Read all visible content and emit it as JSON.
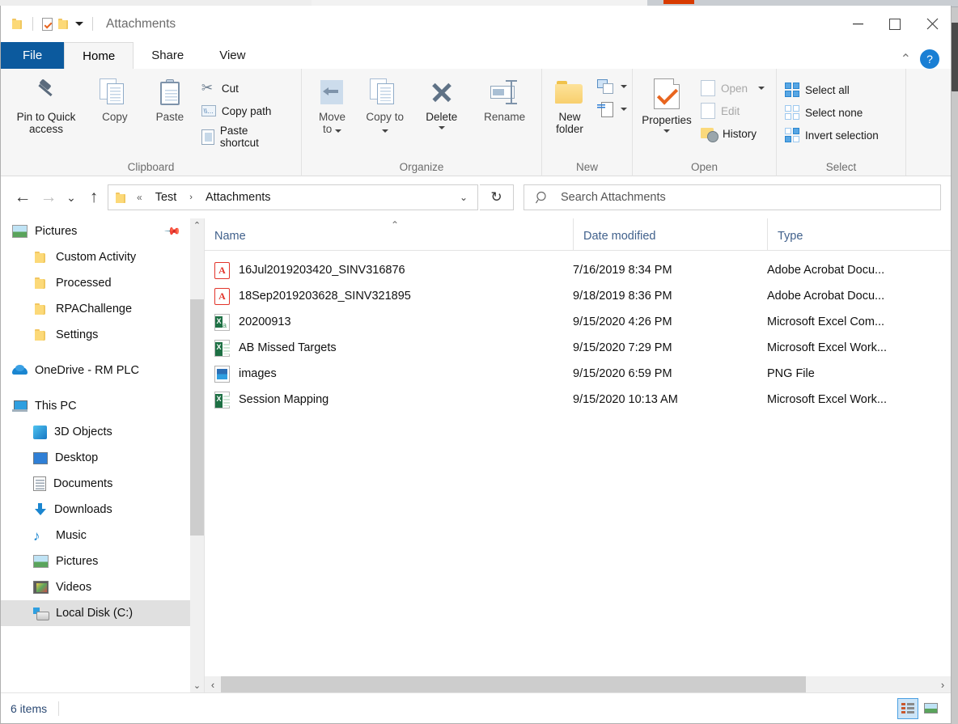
{
  "window": {
    "title": "Attachments",
    "minimize_label": "—",
    "maximize_label": "□",
    "close_label": "✕"
  },
  "quick_access": {
    "folder_icon": "folder-icon",
    "properties_icon": "properties-check-icon",
    "newfolder_icon": "folder-icon",
    "customize_label": "▾"
  },
  "tabs": [
    {
      "label": "File",
      "state": "file"
    },
    {
      "label": "Home",
      "state": "active"
    },
    {
      "label": "Share",
      "state": "normal"
    },
    {
      "label": "View",
      "state": "normal"
    }
  ],
  "ribbon_controls": {
    "collapse_label": "⌃",
    "help_label": "?"
  },
  "ribbon": {
    "groups": [
      {
        "label": "Clipboard",
        "big": [
          {
            "label": "Pin to Quick access",
            "icon": "pin-icon"
          },
          {
            "label": "Copy",
            "icon": "copy-icon"
          },
          {
            "label": "Paste",
            "icon": "paste-icon"
          }
        ],
        "small": [
          {
            "label": "Cut",
            "icon": "scissors-icon"
          },
          {
            "label": "Copy path",
            "icon": "copy-path-icon"
          },
          {
            "label": "Paste shortcut",
            "icon": "paste-shortcut-icon"
          }
        ]
      },
      {
        "label": "Organize",
        "big": [
          {
            "label": "Move to",
            "icon": "move-to-icon"
          },
          {
            "label": "Copy to",
            "icon": "copy-to-icon"
          },
          {
            "label": "Delete",
            "icon": "delete-x-icon"
          },
          {
            "label": "Rename",
            "icon": "rename-icon"
          }
        ],
        "small": []
      },
      {
        "label": "New",
        "big": [
          {
            "label": "New folder",
            "icon": "new-folder-icon"
          }
        ],
        "small": [
          {
            "label": "",
            "icon": "new-item-icon"
          },
          {
            "label": "",
            "icon": "easy-access-icon"
          }
        ]
      },
      {
        "label": "Open",
        "big": [
          {
            "label": "Properties",
            "icon": "properties-icon"
          }
        ],
        "small": [
          {
            "label": "Open",
            "icon": "open-icon"
          },
          {
            "label": "Edit",
            "icon": "edit-icon"
          },
          {
            "label": "History",
            "icon": "history-icon"
          }
        ]
      },
      {
        "label": "Select",
        "big": [],
        "small": [
          {
            "label": "Select all",
            "icon": "select-all-icon"
          },
          {
            "label": "Select none",
            "icon": "select-none-icon"
          },
          {
            "label": "Invert selection",
            "icon": "invert-selection-icon"
          }
        ]
      }
    ]
  },
  "address": {
    "back_label": "←",
    "forward_label": "→",
    "recent_label": "⌄",
    "up_label": "↑",
    "overflow_label": "«",
    "crumbs": [
      "Test",
      "Attachments"
    ],
    "crumb_separator": "›",
    "dropdown_label": "⌄",
    "refresh_label": "↻"
  },
  "search": {
    "icon": "search-icon",
    "placeholder": "Search Attachments"
  },
  "sidebar": {
    "items": [
      {
        "label": "Pictures",
        "icon": "picture-icon",
        "indent": "root",
        "pinned": true
      },
      {
        "label": "Custom Activity",
        "icon": "folder-icon",
        "indent": "ind1"
      },
      {
        "label": "Processed",
        "icon": "folder-icon",
        "indent": "ind1"
      },
      {
        "label": "RPAChallenge",
        "icon": "folder-icon",
        "indent": "ind1"
      },
      {
        "label": "Settings",
        "icon": "folder-icon",
        "indent": "ind1"
      },
      {
        "label": "OneDrive - RM PLC",
        "icon": "cloud-icon",
        "indent": "root"
      },
      {
        "label": "This PC",
        "icon": "this-pc-icon",
        "indent": "root"
      },
      {
        "label": "3D Objects",
        "icon": "cube-icon",
        "indent": "ind1"
      },
      {
        "label": "Desktop",
        "icon": "desktop-icon",
        "indent": "ind1"
      },
      {
        "label": "Documents",
        "icon": "documents-icon",
        "indent": "ind1"
      },
      {
        "label": "Downloads",
        "icon": "downloads-icon",
        "indent": "ind1"
      },
      {
        "label": "Music",
        "icon": "music-icon",
        "indent": "ind1"
      },
      {
        "label": "Pictures",
        "icon": "picture-icon",
        "indent": "ind1"
      },
      {
        "label": "Videos",
        "icon": "videos-icon",
        "indent": "ind1"
      },
      {
        "label": "Local Disk (C:)",
        "icon": "disk-icon",
        "indent": "ind1",
        "selected": true
      }
    ],
    "scroll_up_label": "⌃",
    "scroll_down_label": "⌄",
    "pin_glyph": "📌"
  },
  "file_list": {
    "columns": [
      "Name",
      "Date modified",
      "Type"
    ],
    "sort_column": "Name",
    "sort_indicator": "⌃",
    "rows": [
      {
        "name": "16Jul2019203420_SINV316876",
        "date": "7/16/2019 8:34 PM",
        "type": "Adobe Acrobat Docu...",
        "icon": "pdf-file-icon"
      },
      {
        "name": "18Sep2019203628_SINV321895",
        "date": "9/18/2019 8:36 PM",
        "type": "Adobe Acrobat Docu...",
        "icon": "pdf-file-icon"
      },
      {
        "name": "20200913",
        "date": "9/15/2020 4:26 PM",
        "type": "Microsoft Excel Com...",
        "icon": "excel-csv-file-icon"
      },
      {
        "name": "AB Missed Targets",
        "date": "9/15/2020 7:29 PM",
        "type": "Microsoft Excel Work...",
        "icon": "excel-file-icon"
      },
      {
        "name": "images",
        "date": "9/15/2020 6:59 PM",
        "type": "PNG File",
        "icon": "png-file-icon"
      },
      {
        "name": "Session Mapping",
        "date": "9/15/2020 10:13 AM",
        "type": "Microsoft Excel Work...",
        "icon": "excel-file-icon"
      }
    ],
    "hscroll_left_label": "‹",
    "hscroll_right_label": "›"
  },
  "status": {
    "item_count": "6 items",
    "view_details_icon": "details-view-icon",
    "view_large_icons_icon": "large-icons-view-icon"
  }
}
